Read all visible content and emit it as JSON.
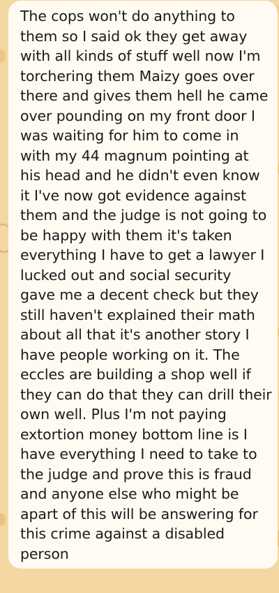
{
  "message": {
    "lines": [
      "The cops won't do anything to",
      "them so I said ok they get away",
      "with all kinds of stuff well now I'm",
      "torchering them Maizy goes over",
      "there and gives them hell he came",
      "over pounding on my front door I",
      "was waiting for him to come in",
      "with my 44 magnum pointing at",
      "his head and he didn't even know",
      "it I've now got evidence against",
      "them and the judge is not going to",
      "be happy with them it's taken",
      "everything I have to get a lawyer I",
      "lucked out and social security",
      "gave me a decent check but they",
      "still haven't explained their math",
      "about all that it's another story I",
      "have people working on it. The",
      "eccles are building a shop well if",
      "they can do that they can drill their",
      "own well. Plus I'm not paying",
      "extortion money bottom line is I",
      "have everything I need to take to",
      "the judge and prove this is fraud",
      "and anyone else who might be",
      "apart of this will be answering for",
      "this crime against a disabled",
      "person"
    ]
  },
  "colors": {
    "wallpaper": "#f5d7a3",
    "bubble": "#fffbf3",
    "text": "#1a1a1a"
  }
}
